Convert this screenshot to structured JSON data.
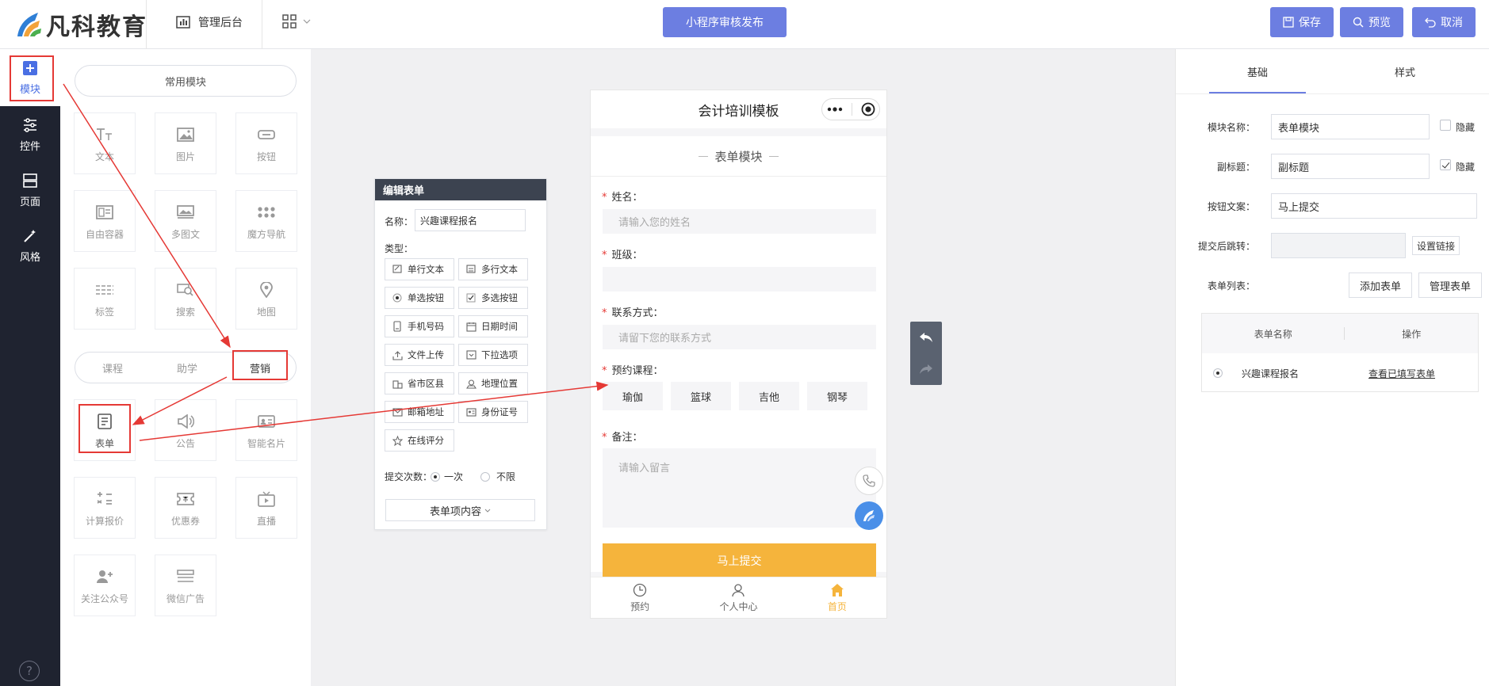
{
  "header": {
    "brand": "凡科教育",
    "admin_label": "管理后台",
    "publish_label": "小程序审核发布",
    "save_label": "保存",
    "preview_label": "预览",
    "cancel_label": "取消"
  },
  "leftnav": {
    "items": [
      {
        "label": "模块",
        "icon": "plus-square-icon"
      },
      {
        "label": "控件",
        "icon": "sliders-icon"
      },
      {
        "label": "页面",
        "icon": "layout-icon"
      },
      {
        "label": "风格",
        "icon": "magic-wand-icon"
      }
    ],
    "help_label": "?"
  },
  "modules": {
    "common_tab": "常用模块",
    "common": [
      {
        "label": "文本",
        "icon": "text-icon"
      },
      {
        "label": "图片",
        "icon": "image-icon"
      },
      {
        "label": "按钮",
        "icon": "button-icon"
      },
      {
        "label": "自由容器",
        "icon": "container-icon"
      },
      {
        "label": "多图文",
        "icon": "multi-image-icon"
      },
      {
        "label": "魔方导航",
        "icon": "cube-nav-icon"
      },
      {
        "label": "标签",
        "icon": "tag-icon"
      },
      {
        "label": "搜索",
        "icon": "search-icon"
      },
      {
        "label": "地图",
        "icon": "map-pin-icon"
      }
    ],
    "segments": [
      "课程",
      "助学",
      "营销"
    ],
    "marketing": [
      {
        "label": "表单",
        "icon": "form-icon"
      },
      {
        "label": "公告",
        "icon": "announce-icon"
      },
      {
        "label": "智能名片",
        "icon": "card-icon"
      },
      {
        "label": "计算报价",
        "icon": "calculator-icon"
      },
      {
        "label": "优惠券",
        "icon": "coupon-icon"
      },
      {
        "label": "直播",
        "icon": "tv-icon"
      },
      {
        "label": "关注公众号",
        "icon": "follow-user-icon"
      },
      {
        "label": "微信广告",
        "icon": "ad-icon"
      }
    ]
  },
  "edit_form": {
    "title": "编辑表单",
    "name_label": "名称：",
    "name_value": "兴趣课程报名",
    "type_label": "类型：",
    "types": [
      "单行文本",
      "多行文本",
      "单选按钮",
      "多选按钮",
      "手机号码",
      "日期时间",
      "文件上传",
      "下拉选项",
      "省市区县",
      "地理位置",
      "邮箱地址",
      "身份证号",
      "在线评分"
    ],
    "submit_count_label": "提交次数：",
    "once_label": "一次",
    "unlimited_label": "不限",
    "content_btn": "表单项内容"
  },
  "phone": {
    "title": "会计培训模板",
    "module_title": "表单模块",
    "fields": [
      {
        "label": "姓名：",
        "placeholder": "请输入您的姓名"
      },
      {
        "label": "班级：",
        "placeholder": ""
      },
      {
        "label": "联系方式：",
        "placeholder": "请留下您的联系方式"
      }
    ],
    "course_label": "预约课程：",
    "courses": [
      "瑜伽",
      "篮球",
      "吉他",
      "钢琴"
    ],
    "remark_label": "备注：",
    "remark_placeholder": "请输入留言",
    "submit_label": "马上提交",
    "tabs": [
      {
        "label": "预约",
        "icon": "clock-icon"
      },
      {
        "label": "个人中心",
        "icon": "user-icon"
      },
      {
        "label": "首页",
        "icon": "home-icon"
      }
    ]
  },
  "right": {
    "tab_basic": "基础",
    "tab_style": "样式",
    "module_name_label": "模块名称：",
    "module_name_value": "表单模块",
    "subtitle_label": "副标题：",
    "subtitle_value": "副标题",
    "hide_label": "隐藏",
    "btn_text_label": "按钮文案：",
    "btn_text_value": "马上提交",
    "jump_label": "提交后跳转：",
    "set_link_label": "设置链接",
    "form_list_label": "表单列表：",
    "add_form_label": "添加表单",
    "manage_form_label": "管理表单",
    "table_col_name": "表单名称",
    "table_col_action": "操作",
    "table_row_name": "兴趣课程报名",
    "table_row_action": "查看已填写表单"
  },
  "colors": {
    "accent": "#6c7ee1",
    "nav_dark": "#1f2330",
    "submit_orange": "#f5b43c",
    "annotation_red": "#e53935"
  }
}
